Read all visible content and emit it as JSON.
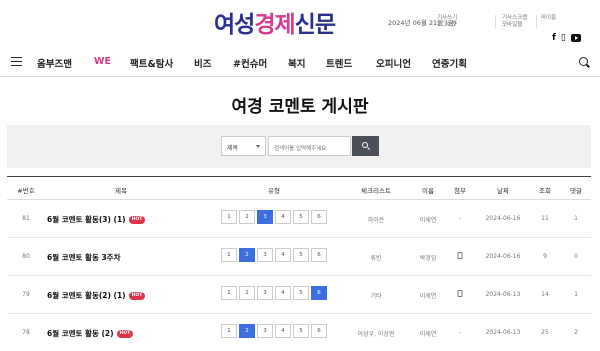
{
  "header": {
    "logo": [
      "여성",
      "경제",
      "신문"
    ],
    "date": "2024년 06월 21일 (금)",
    "util_1": [
      "기사쓰기",
      "로그아웃"
    ],
    "util_2": [
      "기사스크랩",
      "모바일웹"
    ],
    "util_3": "마이홈",
    "socials": [
      "facebook-icon",
      "share-icon",
      "youtube-icon"
    ],
    "social_glyphs": [
      "f",
      "▯"
    ]
  },
  "nav": {
    "items": [
      "옴부즈맨",
      "WE",
      "팩트&탐사",
      "비즈",
      "#컨슈머",
      "복지",
      "트렌드",
      "오피니언",
      "연중기획"
    ]
  },
  "board": {
    "title": "여경 코멘토 게시판",
    "search": {
      "select_value": "제목",
      "placeholder": "검색어를 입력해주세요"
    },
    "columns": [
      "#번호",
      "제목",
      "유형",
      "체크리스트",
      "이름",
      "첨부",
      "날짜",
      "조회",
      "댓글"
    ],
    "scale_labels": [
      "1",
      "2",
      "3",
      "4",
      "5",
      "6"
    ],
    "hot_label": "HOT",
    "rows": [
      {
        "no": "81",
        "title": "6월 코멘토 활동(3) (1)",
        "hot": true,
        "selected": 3,
        "checklist": "하아은",
        "name": "이세연",
        "attach": "-",
        "date": "2024-06-16",
        "views": "11",
        "comments": "1"
      },
      {
        "no": "80",
        "title": "6월 코멘토 활동 3주차",
        "hot": false,
        "selected": 2,
        "checklist": "류빈",
        "name": "박경임",
        "attach": "file",
        "date": "2024-06-16",
        "views": "9",
        "comments": "0"
      },
      {
        "no": "79",
        "title": "6월 코멘토 활동(2) (1)",
        "hot": true,
        "selected": 6,
        "checklist": "기타",
        "name": "이세연",
        "attach": "file",
        "date": "2024-06-13",
        "views": "14",
        "comments": "1"
      },
      {
        "no": "78",
        "title": "6월 코멘토 활동 (2)",
        "hot": true,
        "selected": 2,
        "checklist": "이상우, 이상현",
        "name": "이세연",
        "attach": "-",
        "date": "2024-06-13",
        "views": "25",
        "comments": "2"
      }
    ]
  }
}
